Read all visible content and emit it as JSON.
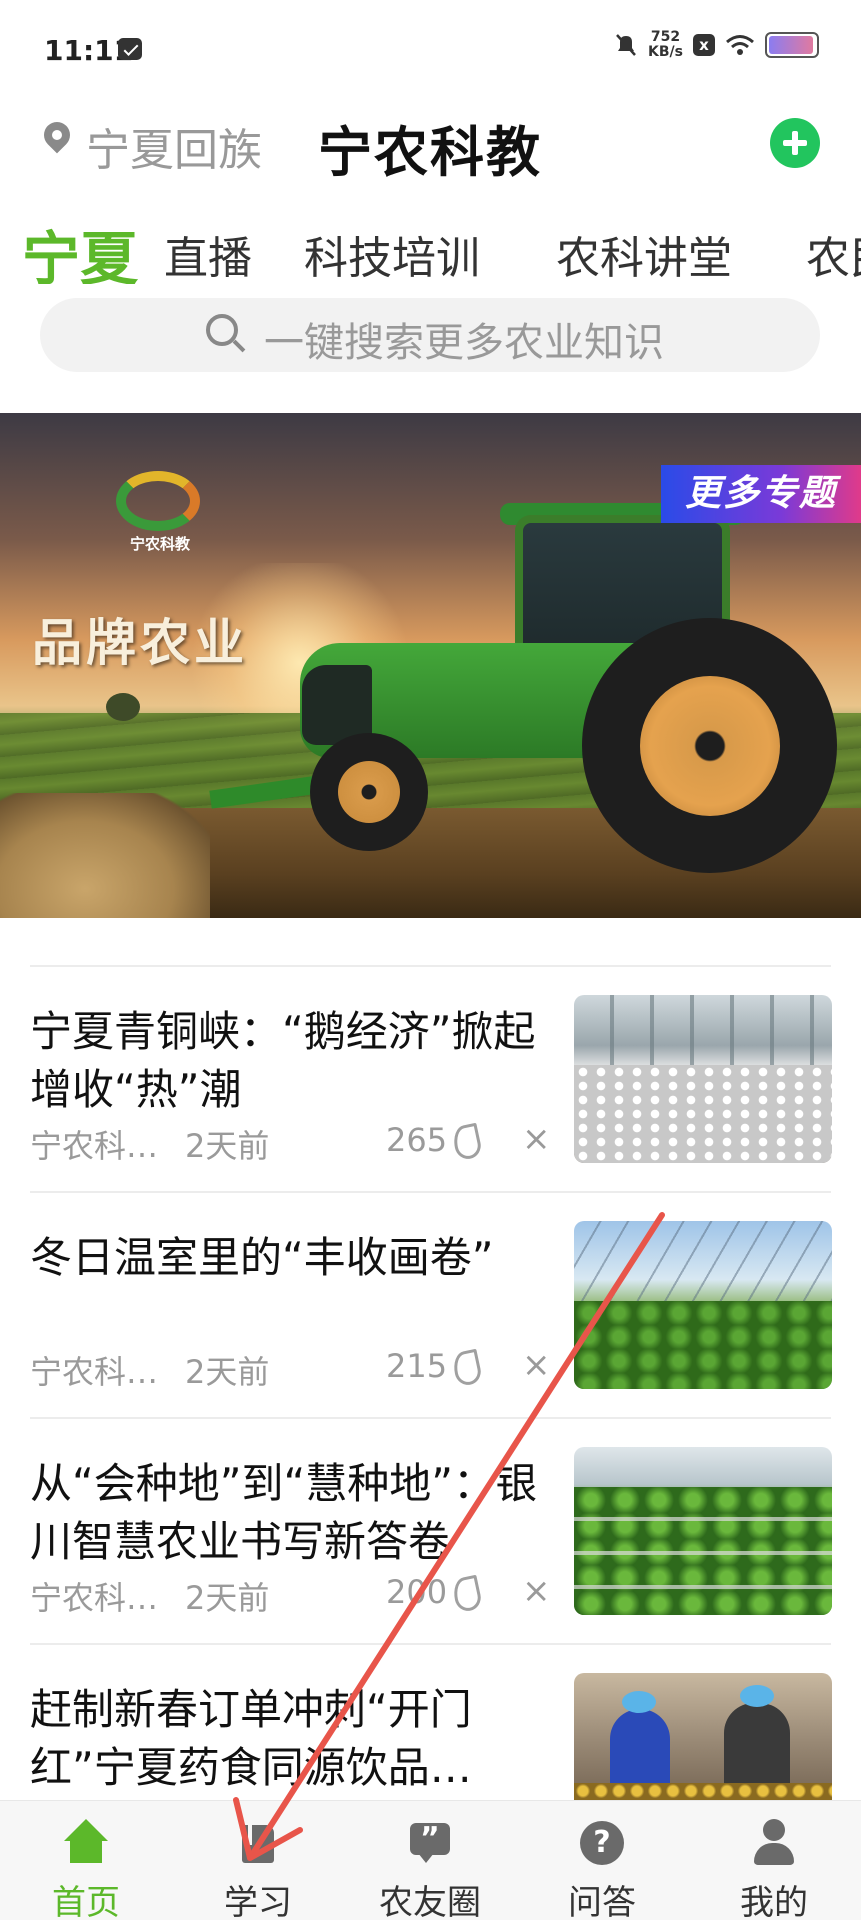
{
  "status_bar": {
    "time": "11:11",
    "net_speed_value": "752",
    "net_speed_unit": "KB/s",
    "box_icon_text": "x",
    "battery_fill_fraction": 0.95
  },
  "header": {
    "location": "宁夏回族",
    "title": "宁农科教",
    "add_icon": "plus-circle-icon",
    "accent_color": "#22c55e"
  },
  "tabs": [
    {
      "label": "宁夏",
      "active": true
    },
    {
      "label": "直播",
      "active": false
    },
    {
      "label": "科技培训",
      "active": false
    },
    {
      "label": "农科讲堂",
      "active": false
    },
    {
      "label": "农民",
      "active": false
    }
  ],
  "search": {
    "placeholder": "一键搜索更多农业知识"
  },
  "banner": {
    "logo_label": "宁农科教",
    "slogan": "品牌农业",
    "more_topics": "更多专题"
  },
  "news": [
    {
      "title": "宁夏青铜峡：“鹅经济”掀起增收“热”潮",
      "source": "宁农科…",
      "time": "2天前",
      "count": "265",
      "thumb": "geese-farm"
    },
    {
      "title": "冬日温室里的“丰收画卷”",
      "source": "宁农科…",
      "time": "2天前",
      "count": "215",
      "thumb": "greenhouse-crops"
    },
    {
      "title": "从“会种地”到“慧种地”：银川智慧农业书写新答卷",
      "source": "宁农科…",
      "time": "2天前",
      "count": "200",
      "thumb": "strawberry-greenhouse"
    },
    {
      "title": "赶制新春订单冲刺“开门红”宁夏药食同源饮品…",
      "source": "",
      "time": "",
      "count": "",
      "thumb": "factory-workers"
    }
  ],
  "bottom_nav": [
    {
      "label": "首页",
      "icon": "home-icon",
      "active": true
    },
    {
      "label": "学习",
      "icon": "book-icon",
      "active": false
    },
    {
      "label": "农友圈",
      "icon": "quote-bubble-icon",
      "active": false
    },
    {
      "label": "问答",
      "icon": "question-icon",
      "active": false
    },
    {
      "label": "我的",
      "icon": "user-icon",
      "active": false
    }
  ],
  "colors": {
    "accent_green": "#5cb82a",
    "annotation_arrow": "#e8554a"
  }
}
